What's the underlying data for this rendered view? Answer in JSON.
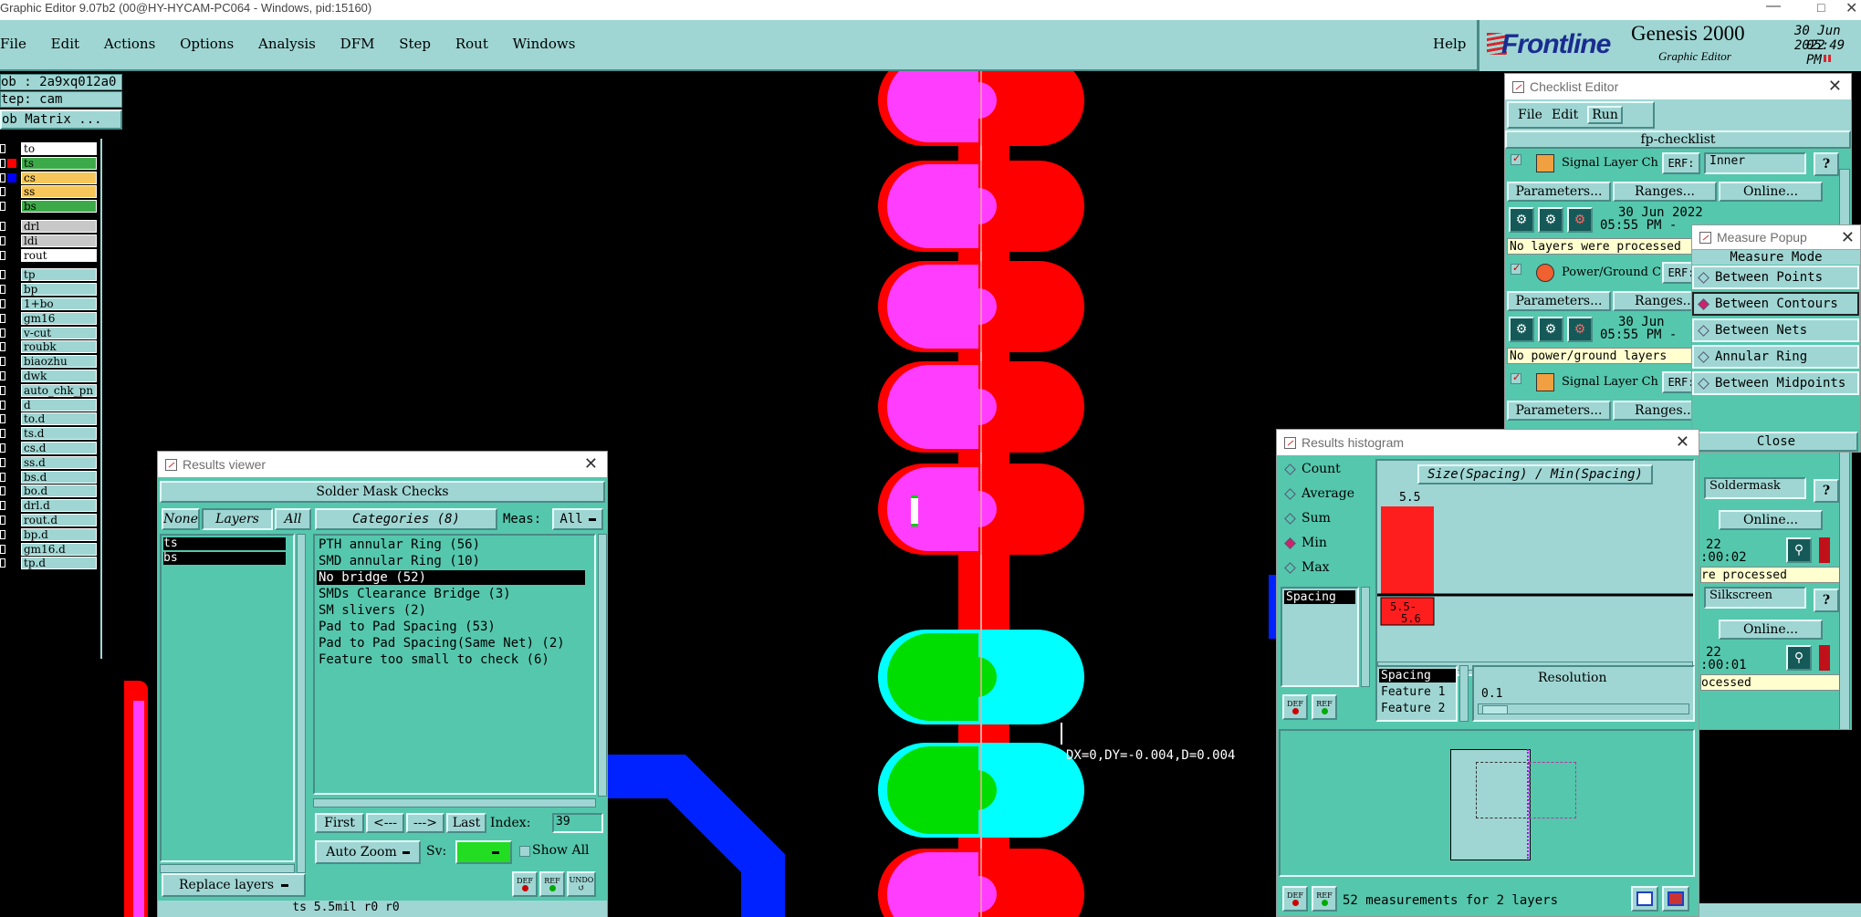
{
  "app": {
    "title": "Graphic Editor 9.07b2 (00@HY-HYCAM-PC064 - Windows, pid:15160)",
    "menu": [
      "File",
      "Edit",
      "Actions",
      "Options",
      "Analysis",
      "DFM",
      "Step",
      "Rout",
      "Windows"
    ],
    "help": "Help",
    "brand": "Frontline",
    "product": "Genesis 2000",
    "subtitle": "Graphic Editor",
    "date": "30 Jun 2022",
    "time": "05:49 PM"
  },
  "left": {
    "job": "ob : 2a9xq012a0",
    "step": "tep: cam",
    "matrix_btn": "ob Matrix ...",
    "layers": [
      {
        "name": "to",
        "bg": "#ffffff",
        "mark": "#000000"
      },
      {
        "name": "ts",
        "bg": "#3daa4a",
        "mark": "#ff0000"
      },
      {
        "name": "cs",
        "bg": "#f6c65a",
        "mark": "#0000ff"
      },
      {
        "name": "ss",
        "bg": "#f6c65a",
        "mark": "#000000"
      },
      {
        "name": "bs",
        "bg": "#3daa4a",
        "mark": "#000000"
      },
      {
        "name": "drl",
        "bg": "#c8c8c8",
        "mark": "#000000"
      },
      {
        "name": "ldi",
        "bg": "#c8c8c8",
        "mark": "#000000"
      },
      {
        "name": "rout",
        "bg": "#ffffff",
        "mark": "#000000"
      },
      {
        "name": "tp",
        "bg": "#9fd6d3",
        "mark": "#000000"
      },
      {
        "name": "bp",
        "bg": "#9fd6d3",
        "mark": "#000000"
      },
      {
        "name": "1+bo",
        "bg": "#9fd6d3",
        "mark": "#000000"
      },
      {
        "name": "gm16",
        "bg": "#9fd6d3",
        "mark": "#000000"
      },
      {
        "name": "v-cut",
        "bg": "#9fd6d3",
        "mark": "#000000"
      },
      {
        "name": "roubk",
        "bg": "#9fd6d3",
        "mark": "#000000"
      },
      {
        "name": "biaozhu",
        "bg": "#9fd6d3",
        "mark": "#000000"
      },
      {
        "name": "dwk",
        "bg": "#9fd6d3",
        "mark": "#000000"
      },
      {
        "name": "auto_chk_pn",
        "bg": "#9fd6d3",
        "mark": "#000000"
      },
      {
        "name": "d",
        "bg": "#9fd6d3",
        "mark": "#000000"
      },
      {
        "name": "to.d",
        "bg": "#9fd6d3",
        "mark": "#000000"
      },
      {
        "name": "ts.d",
        "bg": "#9fd6d3",
        "mark": "#000000"
      },
      {
        "name": "cs.d",
        "bg": "#9fd6d3",
        "mark": "#000000"
      },
      {
        "name": "ss.d",
        "bg": "#9fd6d3",
        "mark": "#000000"
      },
      {
        "name": "bs.d",
        "bg": "#9fd6d3",
        "mark": "#000000"
      },
      {
        "name": "bo.d",
        "bg": "#9fd6d3",
        "mark": "#000000"
      },
      {
        "name": "drl.d",
        "bg": "#9fd6d3",
        "mark": "#000000"
      },
      {
        "name": "rout.d",
        "bg": "#9fd6d3",
        "mark": "#000000"
      },
      {
        "name": "bp.d",
        "bg": "#9fd6d3",
        "mark": "#000000"
      },
      {
        "name": "gm16.d",
        "bg": "#9fd6d3",
        "mark": "#000000"
      },
      {
        "name": "tp.d",
        "bg": "#9fd6d3",
        "mark": "#000000"
      }
    ]
  },
  "canvas": {
    "measure_text": "DX=0,DY=-0.004,D=0.004"
  },
  "results_viewer": {
    "title": "Results viewer",
    "header": "Solder Mask Checks",
    "none": "None",
    "layers": "Layers",
    "all": "All",
    "categories": "Categories (8)",
    "meas_label": "Meas:",
    "meas_value": "All",
    "layer_list": [
      "ts",
      "bs"
    ],
    "category_list": [
      "PTH annular Ring (56)",
      "SMD annular Ring (10)",
      "No bridge (52)",
      "SMDs Clearance Bridge (3)",
      "SM slivers (2)",
      "Pad to Pad Spacing (53)",
      "Pad to Pad Spacing(Same Net) (2)",
      "Feature too small to check (6)"
    ],
    "selected_category": "No bridge (52)",
    "first": "First",
    "prev": "<---",
    "next": "--->",
    "last": "Last",
    "index_label": "Index:",
    "index_value": "39",
    "auto_zoom": "Auto Zoom",
    "sv_label": "Sv:",
    "show_all": "Show All",
    "replace_layers": "Replace layers",
    "status": "ts 5.5mil  r0  r0",
    "def": "DEF",
    "ref": "REF",
    "undo": "UNDO"
  },
  "checklist": {
    "title": "Checklist Editor",
    "menu": [
      "File",
      "Edit",
      "Run"
    ],
    "name": "fp-checklist",
    "items": [
      {
        "label": "Signal Layer Ch",
        "erf": "ERF:",
        "erf_value": "Inner",
        "date": "30 Jun 2022",
        "time": "05:55 PM -",
        "msg": "No layers were processed"
      },
      {
        "label": "Power/Ground C",
        "erf": "ERF:",
        "date": "30 Jun",
        "time": "05:55 PM -",
        "msg": "No power/ground layers"
      },
      {
        "label": "Signal Layer Ch",
        "erf": "ERF:"
      }
    ],
    "parameters": "Parameters...",
    "ranges": "Ranges...",
    "online": "Online...",
    "soldermask": "Soldermask",
    "silkscreen": "Silkscreen",
    "sm_date": "22",
    "sm_time": ":00:02",
    "sm_msg": "re processed",
    "ss_date": "22",
    "ss_time": ":00:01",
    "ss_msg": "ocessed",
    "help_q": "?"
  },
  "measure_popup": {
    "title": "Measure Popup",
    "mode_header": "Measure Mode",
    "modes": [
      "Between Points",
      "Between Contours",
      "Between Nets",
      "Annular Ring",
      "Between Midpoints"
    ],
    "selected": "Between Contours",
    "close": "Close"
  },
  "histogram": {
    "title": "Results histogram",
    "stats": [
      "Count",
      "Average",
      "Sum",
      "Min",
      "Max"
    ],
    "selected_stat": "Min",
    "attr_list": [
      "Spacing"
    ],
    "chart_title": "Size(Spacing) / Min(Spacing)",
    "bar_label": "5.5",
    "bin_label": "5.5-\n5.6",
    "fields": [
      "Spacing",
      "Feature 1",
      "Feature 2"
    ],
    "resolution_label": "Resolution",
    "resolution_value": "0.1",
    "status": "52 measurements for 2 layers",
    "def": "DEF",
    "ref": "REF"
  },
  "chart_data": {
    "type": "bar",
    "categories": [
      "5.5-5.6"
    ],
    "values": [
      5.5
    ],
    "title": "Size(Spacing) / Min(Spacing)",
    "xlabel": "",
    "ylabel": ""
  },
  "colors": {
    "ui_teal": "#9fd6d3",
    "panel_green": "#55c7ad",
    "pad_red": "#ff0000",
    "pad_magenta": "#ff3dff",
    "pad_cyan": "#00ffff",
    "pad_green": "#00dd00",
    "trace_blue": "#0022ff"
  }
}
